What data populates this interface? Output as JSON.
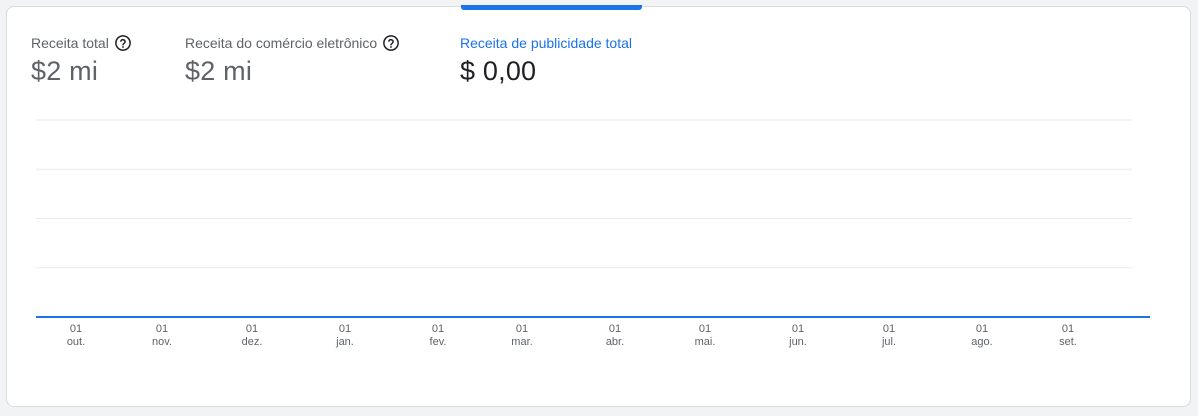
{
  "metrics": [
    {
      "label": "Receita total",
      "value": "$2 mi",
      "has_help": true
    },
    {
      "label": "Receita do comércio eletrônico",
      "value": "$2 mi",
      "has_help": true
    },
    {
      "label": "Receita de publicidade total",
      "value": "$ 0,00",
      "has_help": false,
      "selected": true
    }
  ],
  "colors": {
    "accent": "#1a73e8",
    "grid": "#e8eaed",
    "label": "#5f6368",
    "value_active": "#202124"
  },
  "chart_data": {
    "type": "line",
    "x": [
      "01 out.",
      "01 nov.",
      "01 dez.",
      "01 jan.",
      "01 fev.",
      "01 mar.",
      "01 abr.",
      "01 mai.",
      "01 jun.",
      "01 jul.",
      "01 ago.",
      "01 set."
    ],
    "x_tick_labels": [
      {
        "day": "01",
        "month": "out."
      },
      {
        "day": "01",
        "month": "nov."
      },
      {
        "day": "01",
        "month": "dez."
      },
      {
        "day": "01",
        "month": "jan."
      },
      {
        "day": "01",
        "month": "fev."
      },
      {
        "day": "01",
        "month": "mar."
      },
      {
        "day": "01",
        "month": "abr."
      },
      {
        "day": "01",
        "month": "mai."
      },
      {
        "day": "01",
        "month": "jun."
      },
      {
        "day": "01",
        "month": "jul."
      },
      {
        "day": "01",
        "month": "ago."
      },
      {
        "day": "01",
        "month": "set."
      }
    ],
    "series": [
      {
        "values": [
          0,
          0,
          0,
          0,
          0,
          0,
          0,
          0,
          0,
          0,
          0,
          0
        ]
      }
    ],
    "ylim": [
      0,
      4
    ],
    "grid": true,
    "legend": false
  }
}
